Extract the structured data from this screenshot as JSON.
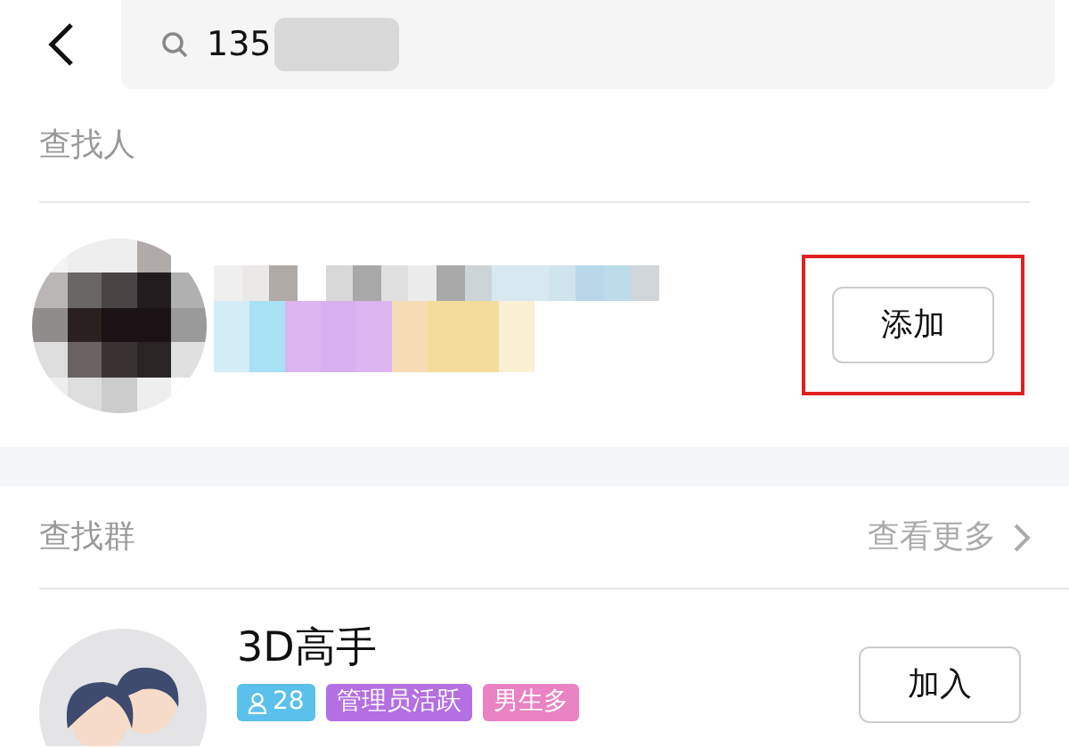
{
  "search": {
    "value": "135"
  },
  "people_section": {
    "title": "查找人",
    "results": [
      {
        "button": "添加",
        "highlighted": true
      }
    ]
  },
  "groups_section": {
    "title": "查找群",
    "more": "查看更多",
    "results": [
      {
        "name": "3D高手",
        "tags": [
          {
            "kind": "members",
            "text": "28",
            "color": "#5bc0eb"
          },
          {
            "kind": "label",
            "text": "管理员活跃",
            "color": "#b46fe3"
          },
          {
            "kind": "label",
            "text": "男生多",
            "color": "#ea82c3"
          }
        ],
        "button": "加入"
      }
    ]
  }
}
